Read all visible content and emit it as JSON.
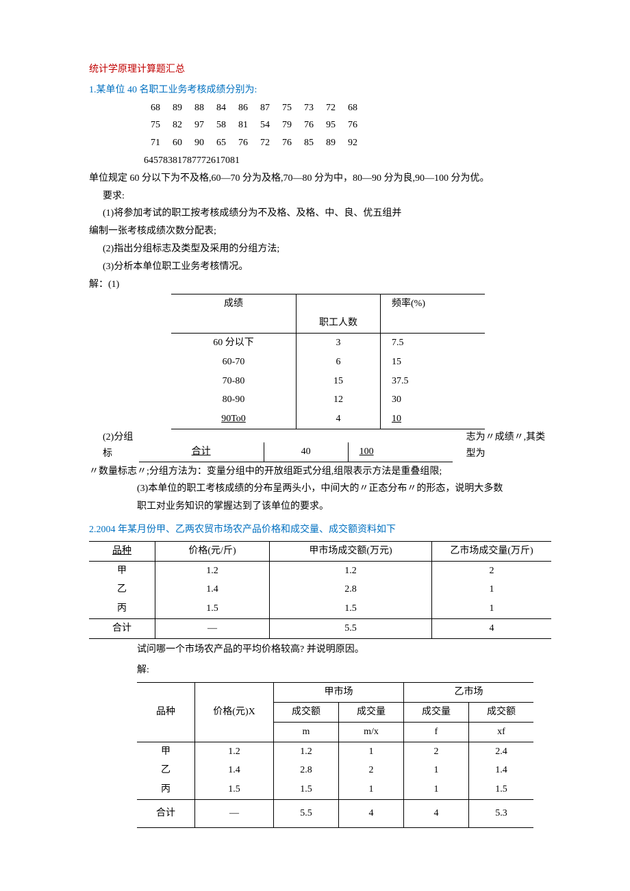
{
  "title_main": "统计学原理计算题汇总",
  "q1": {
    "heading": "1.某单位 40 名职工业务考核成绩分别为:",
    "rows": [
      [
        "68",
        "89",
        "88",
        "84",
        "86",
        "87",
        "75",
        "73",
        "72",
        "68"
      ],
      [
        "75",
        "82",
        "97",
        "58",
        "81",
        "54",
        "79",
        "76",
        "95",
        "76"
      ],
      [
        "71",
        "60",
        "90",
        "65",
        "76",
        "72",
        "76",
        "85",
        "89",
        "92"
      ]
    ],
    "extra": "64578381787772617081",
    "rule": "单位规定 60 分以下为不及格,60—70 分为及格,70—80 分为中，80—90 分为良,90—100 分为优。",
    "req_label": "要求:",
    "req1": "(1)将参加考试的职工按考核成绩分为不及格、及格、中、良、优五组并",
    "req1b": "编制一张考核成绩次数分配表;",
    "req2": "(2)指出分组标志及类型及采用的分组方法;",
    "req3": "(3)分析本单位职工业务考核情况。",
    "sol_label": "解：(1)",
    "t1": {
      "h_score": "成绩",
      "h_count": "职工人数",
      "h_freq": "频率(%)",
      "rows": [
        [
          "60 分以下",
          "3",
          "7.5"
        ],
        [
          "60-70",
          "6",
          "15"
        ],
        [
          "70-80",
          "15",
          "37.5"
        ],
        [
          "80-90",
          "12",
          "30"
        ],
        [
          "90To0",
          "4",
          "10"
        ]
      ],
      "total_label": "合计",
      "total_count": "40",
      "total_freq": "100"
    },
    "ans2_pre": "(2)分组标",
    "ans2_post": "志为〃成绩〃,其类型为",
    "ans2_line2": "〃数量标志〃;分组方法为：变量分组中的开放组距式分组,组限表示方法是重叠组限;",
    "ans3_a": "(3)本单位的职工考核成绩的分布呈两头小，中间大的〃正态分布〃的形态，说明大多数",
    "ans3_b": "职工对业务知识的掌握达到了该单位的要求。"
  },
  "q2": {
    "heading": "2.2004 年某月份甲、乙两农贸市场农产品价格和成交量、成交额资料如下",
    "t2": {
      "h_kind": "品种",
      "h_price": "价格(元/斤)",
      "h_a": "甲市场成交额(万元)",
      "h_b": "乙市场成交量(万斤)",
      "rows": [
        [
          "甲",
          "1.2",
          "1.2",
          "2"
        ],
        [
          "乙",
          "1.4",
          "2.8",
          "1"
        ],
        [
          "丙",
          "1.5",
          "1.5",
          "1"
        ]
      ],
      "total": [
        "合计",
        "—",
        "5.5",
        "4"
      ]
    },
    "ask": "试问哪一个市场农产品的平均价格较高? 并说明原因。",
    "sol_label": "解:",
    "t3": {
      "h_kind": "品种",
      "h_price": "价格(元)X",
      "h_mkt_a": "甲市场",
      "h_mkt_b": "乙市场",
      "sub_m": "成交额",
      "sub_mx": "成交量",
      "sub_f": "成交量",
      "sub_xf": "成交额",
      "unit_m": "m",
      "unit_mx": "m/x",
      "unit_f": "f",
      "unit_xf": "xf",
      "rows": [
        [
          "甲",
          "1.2",
          "1.2",
          "1",
          "2",
          "2.4"
        ],
        [
          "乙",
          "1.4",
          "2.8",
          "2",
          "1",
          "1.4"
        ],
        [
          "丙",
          "1.5",
          "1.5",
          "1",
          "1",
          "1.5"
        ]
      ],
      "total": [
        "合计",
        "—",
        "5.5",
        "4",
        "4",
        "5.3"
      ]
    }
  }
}
